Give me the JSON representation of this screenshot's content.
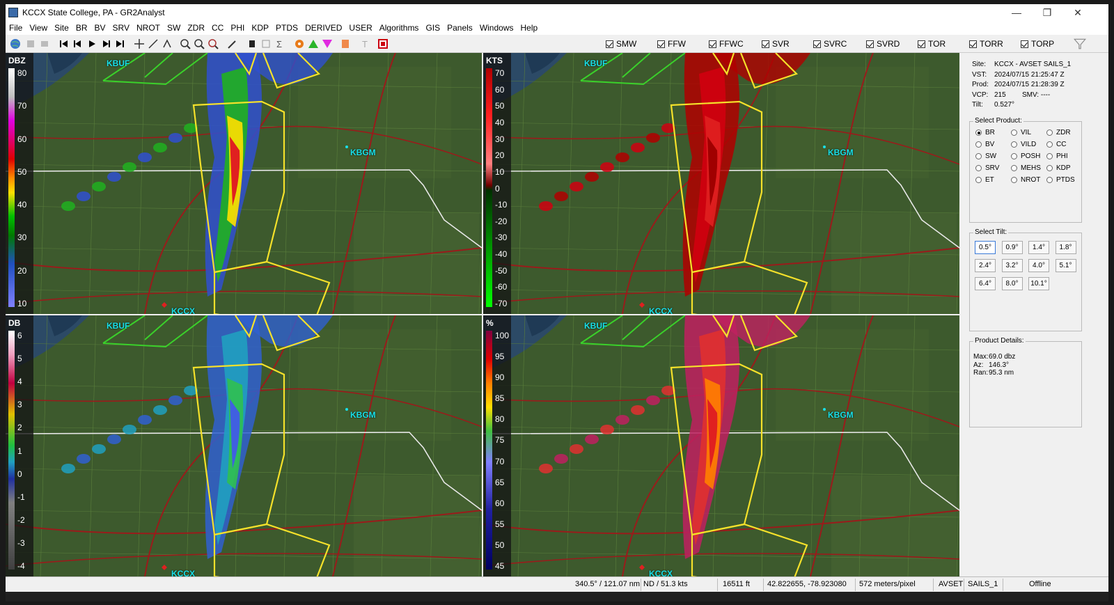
{
  "window": {
    "title": "KCCX State College, PA - GR2Analyst",
    "controls": [
      "—",
      "❐",
      "✕"
    ]
  },
  "menu": [
    "File",
    "View",
    "Site",
    "BR",
    "BV",
    "SRV",
    "NROT",
    "SW",
    "ZDR",
    "CC",
    "PHI",
    "KDP",
    "PTDS",
    "DERIVED",
    "USER",
    "Algorithms",
    "GIS",
    "Panels",
    "Windows",
    "Help"
  ],
  "warnings": [
    "SMW",
    "FFW",
    "FFWC",
    "SVR",
    "SVRC",
    "SVRD",
    "TOR",
    "TORR",
    "TORP"
  ],
  "panels": [
    {
      "unit": "DBZ",
      "labels": [
        "80",
        "70",
        "60",
        "50",
        "40",
        "30",
        "20",
        "10"
      ],
      "sites": [
        "KBUF",
        "KBGM",
        "KCCX"
      ]
    },
    {
      "unit": "KTS",
      "labels": [
        "70",
        "60",
        "50",
        "40",
        "30",
        "20",
        "10",
        "0",
        "-10",
        "-20",
        "-30",
        "-40",
        "-50",
        "-60",
        "-70"
      ],
      "sites": [
        "KBUF",
        "KBGM",
        "KCCX"
      ]
    },
    {
      "unit": "DB",
      "labels": [
        "6",
        "5",
        "4",
        "3",
        "2",
        "1",
        "0",
        "-1",
        "-2",
        "-3",
        "-4"
      ],
      "sites": [
        "KBUF",
        "KBGM",
        "KCCX"
      ]
    },
    {
      "unit": "%",
      "labels": [
        "100",
        "95",
        "90",
        "85",
        "80",
        "75",
        "70",
        "65",
        "60",
        "55",
        "50",
        "45"
      ],
      "sites": [
        "KBUF",
        "KBGM",
        "KCCX"
      ]
    }
  ],
  "info": {
    "site_label": "Site:",
    "site": "KCCX - AVSET SAILS_1",
    "vst_label": "VST:",
    "vst": "2024/07/15  21:25:47 Z",
    "prod_label": "Prod:",
    "prod": "2024/07/15  21:28:39 Z",
    "vcp_label": "VCP:",
    "vcp": "215",
    "smv_label": "SMV:",
    "smv": "----",
    "tilt_label": "Tilt:",
    "tilt": "0.527°"
  },
  "select_product": {
    "title": "Select Product:",
    "items": [
      "BR",
      "VIL",
      "ZDR",
      "BV",
      "VILD",
      "CC",
      "SW",
      "POSH",
      "PHI",
      "SRV",
      "MEHS",
      "KDP",
      "ET",
      "NROT",
      "PTDS"
    ],
    "selected": "BR"
  },
  "select_tilt": {
    "title": "Select Tilt:",
    "items": [
      "0.5°",
      "0.9°",
      "1.4°",
      "1.8°",
      "2.4°",
      "3.2°",
      "4.0°",
      "5.1°",
      "6.4°",
      "8.0°",
      "10.1°"
    ],
    "selected": "0.5°"
  },
  "product_details": {
    "title": "Product Details:",
    "max_label": "Max:",
    "max": "69.0 dbz",
    "az_label": "Az:",
    "az": "146.3°",
    "ran_label": "Ran:",
    "ran": "95.3 nm"
  },
  "status": {
    "azran": "340.5° / 121.07 nm",
    "nd": "ND / 51.3 kts",
    "height": "16511 ft",
    "latlon": "42.822655, -78.923080",
    "res": "572 meters/pixel",
    "mode": "AVSET",
    "sails": "SAILS_1",
    "conn": "Offline"
  },
  "colors": {
    "warning_outline": "#f5e12a",
    "severe_outline": "#3ad12a",
    "site_label": "#19e0e8",
    "roads": "#9a1b1b"
  }
}
